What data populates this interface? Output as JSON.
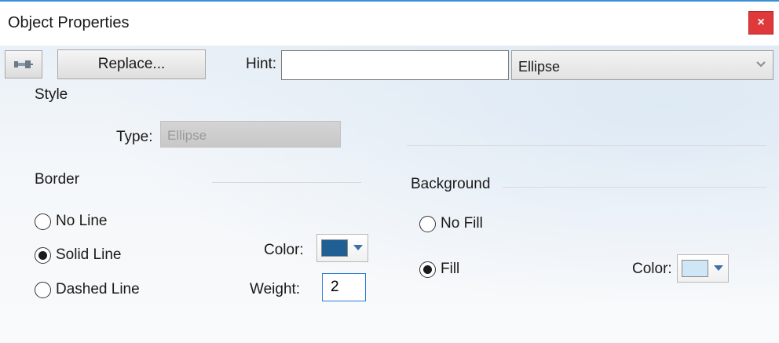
{
  "window": {
    "title": "Object Properties",
    "close_glyph": "×"
  },
  "toolbar": {
    "pin_icon": "pin-icon",
    "replace_label": "Replace...",
    "hint_label": "Hint:",
    "hint_value": "",
    "type_select_value": "Ellipse"
  },
  "style": {
    "heading": "Style",
    "type_label": "Type:",
    "type_value": "Ellipse"
  },
  "border": {
    "heading": "Border",
    "options": [
      "No Line",
      "Solid Line",
      "Dashed Line"
    ],
    "selected": "Solid Line",
    "color_label": "Color:",
    "color_value": "#1f5f94",
    "weight_label": "Weight:",
    "weight_value": "2"
  },
  "background": {
    "heading": "Background",
    "options": [
      "No Fill",
      "Fill"
    ],
    "selected": "Fill",
    "color_label": "Color:",
    "color_value": "#cfe6f7"
  },
  "colors": {
    "accent": "#2a7ad6",
    "close_button": "#e0393b",
    "title_border": "#3b8fd6"
  }
}
